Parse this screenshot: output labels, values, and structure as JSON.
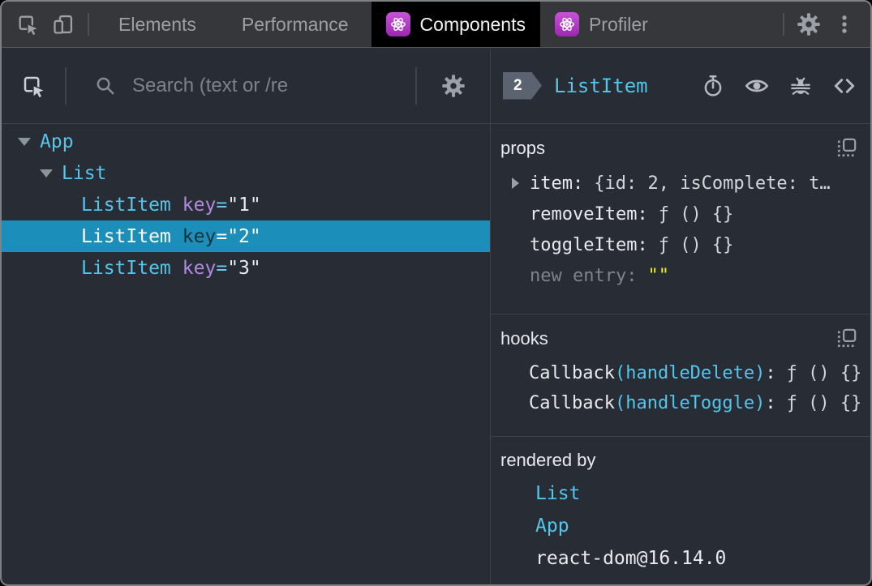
{
  "punct": {
    "colon": ":",
    "eq": "="
  },
  "colors": {
    "selection_bg": "#1b8fba",
    "component_name_cyan": "#53c6ec",
    "attr_name_purple": "#b18ae0",
    "editable_value_yellow": "#f2f210",
    "react_icon_magenta": "#b13ac4",
    "panel_bg": "#282c34",
    "tabbar_bg": "#35373a",
    "active_tab_bg": "#000000"
  },
  "icons": [
    "inspect-cursor-icon",
    "device-toolbar-icon",
    "react-logo-icon",
    "gear-icon",
    "kebab-menu-icon",
    "search-icon",
    "stopwatch-icon",
    "eye-icon",
    "bug-icon",
    "code-brackets-icon",
    "copy-icon",
    "caret-down-icon",
    "caret-right-icon"
  ],
  "tabbar": {
    "tabs": [
      {
        "label": "Elements"
      },
      {
        "label": "Performance"
      },
      {
        "label": "Components"
      },
      {
        "label": "Profiler"
      }
    ]
  },
  "left_panel": {
    "search_placeholder": "Search (text or /re",
    "tree": [
      {
        "name": "App"
      },
      {
        "name": "List"
      },
      {
        "name": "ListItem",
        "attr_name": "key",
        "attr_value": "\"1\""
      },
      {
        "name": "ListItem",
        "attr_name": "key",
        "attr_value": "\"2\""
      },
      {
        "name": "ListItem",
        "attr_name": "key",
        "attr_value": "\"3\""
      }
    ]
  },
  "right_panel": {
    "header": {
      "badge": "2",
      "component_name": "ListItem"
    },
    "props": {
      "title": "props",
      "rows": [
        {
          "name": "item",
          "value": "{id: 2, isComplete: t…"
        },
        {
          "name": "removeItem",
          "value": "ƒ () {}"
        },
        {
          "name": "toggleItem",
          "value": "ƒ () {}"
        },
        {
          "name": "new entry",
          "value": "\"\""
        }
      ]
    },
    "hooks": {
      "title": "hooks",
      "rows": [
        {
          "name": "Callback",
          "arg": "(handleDelete)",
          "value": "ƒ () {}"
        },
        {
          "name": "Callback",
          "arg": "(handleToggle)",
          "value": "ƒ () {}"
        }
      ]
    },
    "rendered_by": {
      "title": "rendered by",
      "items": [
        {
          "label": "List"
        },
        {
          "label": "App"
        },
        {
          "label": "react-dom@16.14.0"
        }
      ]
    }
  }
}
